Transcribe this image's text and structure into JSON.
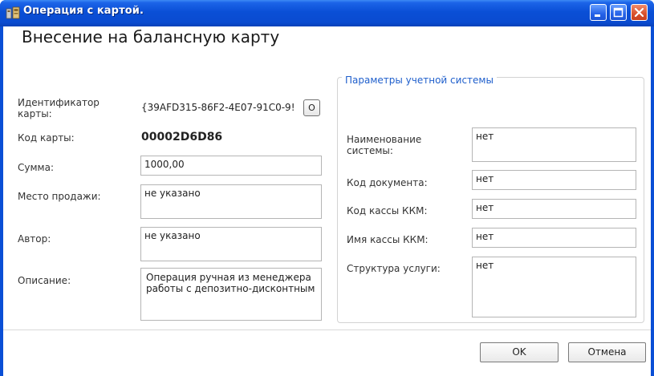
{
  "window": {
    "title": "Операция с картой."
  },
  "heading": "Внесение на балансную карту",
  "left": {
    "card_id_label": "Идентификатор карты:",
    "card_id_value": "{39AFD315-86F2-4E07-91C0-9!",
    "card_id_button": "O",
    "card_code_label": "Код карты:",
    "card_code_value": "00002D6D86",
    "amount_label": "Сумма:",
    "amount_value": "1000,00",
    "sale_place_label": "Место продажи:",
    "sale_place_value": "не указано",
    "author_label": "Автор:",
    "author_value": "не указано",
    "description_label": "Описание:",
    "description_value": "Операция ручная из менеджера работы с депозитно-дисконтным"
  },
  "accounting": {
    "legend": "Параметры учетной системы",
    "system_name_label": "Наименование системы:",
    "system_name_value": "нет",
    "doc_code_label": "Код документа:",
    "doc_code_value": "нет",
    "kkm_code_label": "Код кассы ККМ:",
    "kkm_code_value": "нет",
    "kkm_name_label": "Имя кассы ККМ:",
    "kkm_name_value": "нет",
    "service_struct_label": "Структура услуги:",
    "service_struct_value": "нет"
  },
  "buttons": {
    "ok": "OK",
    "cancel": "Отмена"
  },
  "colors": {
    "titlebar": "#0a4fd6",
    "legend_text": "#1f5fcc",
    "close_button": "#d9512d"
  }
}
